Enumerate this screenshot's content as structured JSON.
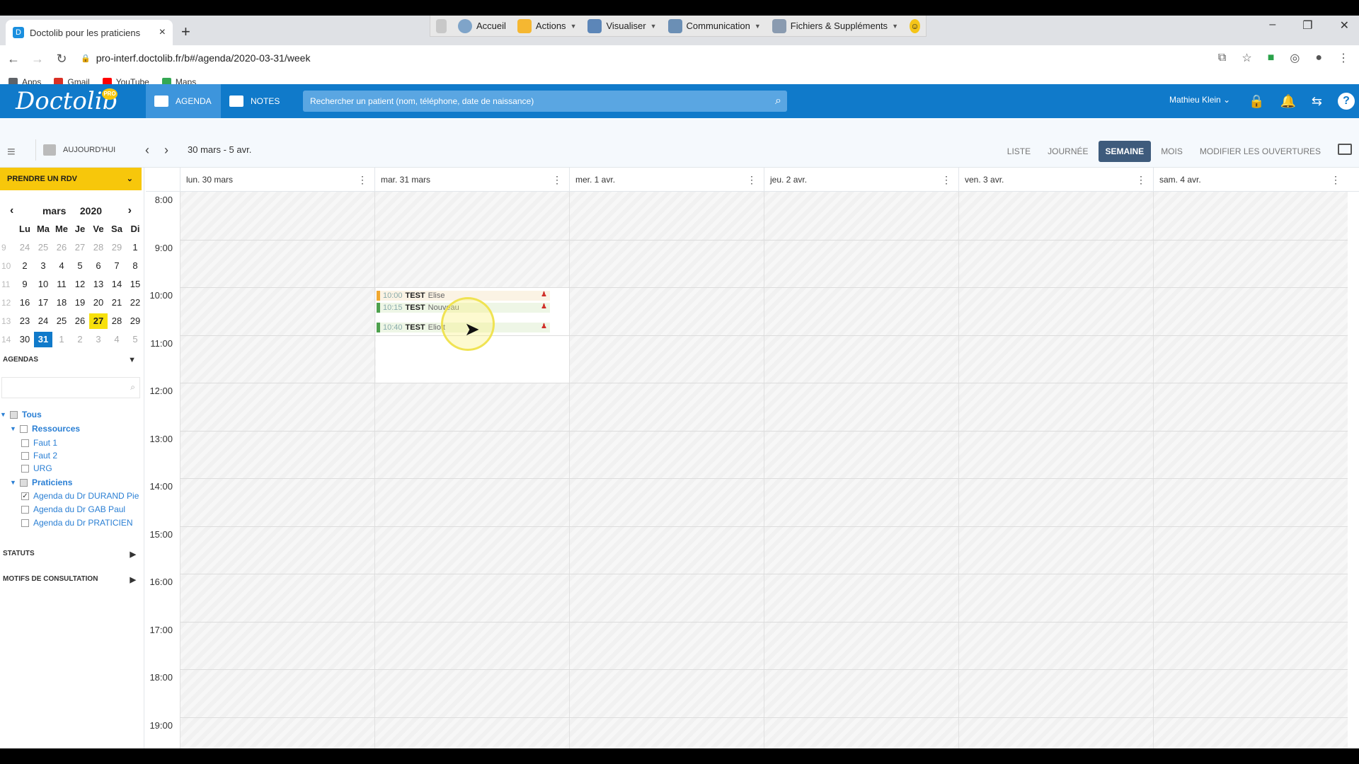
{
  "browser": {
    "tab_title": "Doctolib pour les praticiens",
    "tab_close": "×",
    "new_tab": "+",
    "url": "pro-interf.doctolib.fr/b#/agenda/2020-03-31/week",
    "bookmarks": [
      {
        "label": "Apps",
        "color": "#5f6368"
      },
      {
        "label": "Gmail",
        "color": "#d93025"
      },
      {
        "label": "YouTube",
        "color": "#ff0000"
      },
      {
        "label": "Maps",
        "color": "#34a853"
      }
    ],
    "extension_toolbar": {
      "items": [
        "Accueil",
        "Actions",
        "Visualiser",
        "Communication",
        "Fichiers & Suppléments"
      ]
    }
  },
  "header": {
    "logo": "Doctolib",
    "pro_badge": "PRO",
    "tab_agenda": "AGENDA",
    "tab_notes": "NOTES",
    "search_placeholder": "Rechercher un patient (nom, téléphone, date de naissance)",
    "user": "Mathieu Klein",
    "help": "?",
    "brand_color": "#107aca"
  },
  "toolbar": {
    "today": "AUJOURD'HUI",
    "prev": "‹",
    "next": "›",
    "range": "30 mars - 5 avr.",
    "views": [
      "LISTE",
      "JOURNÉE",
      "SEMAINE",
      "MOIS",
      "MODIFIER LES OUVERTURES"
    ],
    "active_view": "SEMAINE"
  },
  "sidebar": {
    "new_appointment": "PRENDRE UN RDV",
    "minical": {
      "month": "mars",
      "year": "2020",
      "weekdays": [
        "Lu",
        "Ma",
        "Me",
        "Je",
        "Ve",
        "Sa",
        "Di"
      ],
      "weeks": [
        {
          "wk": "9",
          "days": [
            "24",
            "25",
            "26",
            "27",
            "28",
            "29",
            "1"
          ]
        },
        {
          "wk": "10",
          "days": [
            "2",
            "3",
            "4",
            "5",
            "6",
            "7",
            "8"
          ]
        },
        {
          "wk": "11",
          "days": [
            "9",
            "10",
            "11",
            "12",
            "13",
            "14",
            "15"
          ]
        },
        {
          "wk": "12",
          "days": [
            "16",
            "17",
            "18",
            "19",
            "20",
            "21",
            "22"
          ]
        },
        {
          "wk": "13",
          "days": [
            "23",
            "24",
            "25",
            "26",
            "27",
            "28",
            "29"
          ]
        },
        {
          "wk": "14",
          "days": [
            "30",
            "31",
            "1",
            "2",
            "3",
            "4",
            "5"
          ]
        }
      ],
      "today": "27",
      "selected": "31"
    },
    "agendas_label": "AGENDAS",
    "tree": {
      "all": "Tous",
      "resources": "Ressources",
      "resource_items": [
        "Faut 1",
        "Faut 2",
        "URG"
      ],
      "practitioners": "Praticiens",
      "practitioner_items": [
        "Agenda du Dr DURAND Pie",
        "Agenda du Dr GAB Paul",
        "Agenda du Dr PRATICIEN"
      ]
    },
    "statuts_label": "STATUTS",
    "motifs_label": "MOTIFS DE CONSULTATION"
  },
  "calendar": {
    "days": [
      "lun. 30 mars",
      "mar. 31 mars",
      "mer. 1 avr.",
      "jeu. 2 avr.",
      "ven. 3 avr.",
      "sam. 4 avr."
    ],
    "hours": [
      "8:00",
      "9:00",
      "10:00",
      "11:00",
      "12:00",
      "13:00",
      "14:00",
      "15:00",
      "16:00",
      "17:00",
      "18:00",
      "19:00"
    ],
    "appointments": [
      {
        "time": "10:00",
        "name": "TEST",
        "first": "Elise",
        "color": "orange"
      },
      {
        "time": "10:15",
        "name": "TEST",
        "first": "Nouveau",
        "color": "green"
      },
      {
        "time": "10:40",
        "name": "TEST",
        "first": "Eliott",
        "color": "green"
      }
    ]
  }
}
